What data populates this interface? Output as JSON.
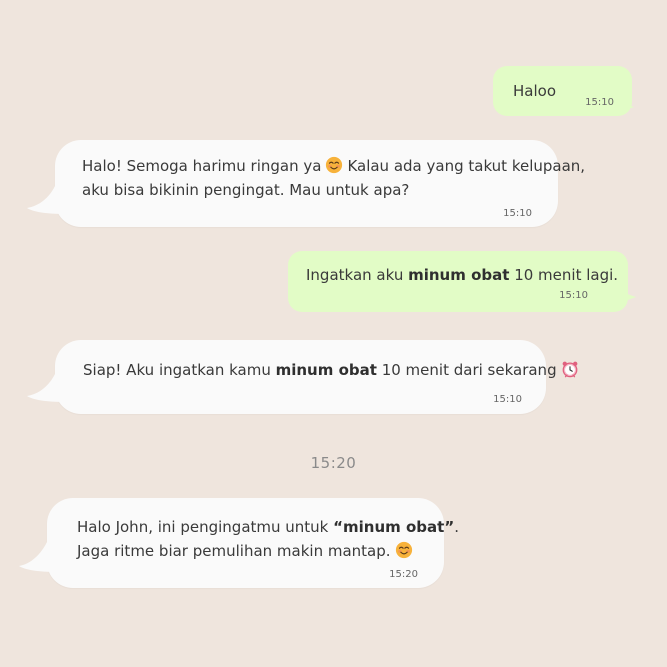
{
  "colors": {
    "background": "#EFE5DD",
    "incoming_bubble": "#FAFAFA",
    "outgoing_bubble": "#E2FCC6"
  },
  "messages": [
    {
      "direction": "outgoing",
      "text": "Haloo",
      "time": "15:10"
    },
    {
      "direction": "incoming",
      "line1_a": "Halo! Semoga harimu ringan ya",
      "line1_emoji": "smiling-face-emoji",
      "line1_b": "Kalau ada yang takut kelupaan,",
      "line2": "aku bisa bikinin pengingat. Mau untuk apa?",
      "time": "15:10"
    },
    {
      "direction": "outgoing",
      "text_a": "Ingatkan aku ",
      "text_bold": "minum obat",
      "text_b": " 10 menit lagi.",
      "time": "15:10"
    },
    {
      "direction": "incoming",
      "text_a": "Siap! Aku ingatkan kamu ",
      "text_bold": "minum obat",
      "text_b": " 10 menit dari sekarang",
      "emoji": "alarm-clock-emoji",
      "time": "15:10"
    },
    {
      "direction": "incoming",
      "line1_a": "Halo John, ini pengingatmu untuk ",
      "line1_bold": "“minum obat”",
      "line1_b": ".",
      "line2": "Jaga ritme biar pemulihan makin mantap.",
      "line2_emoji": "smiling-face-emoji",
      "time": "15:20"
    }
  ],
  "separator_time": "15:20"
}
